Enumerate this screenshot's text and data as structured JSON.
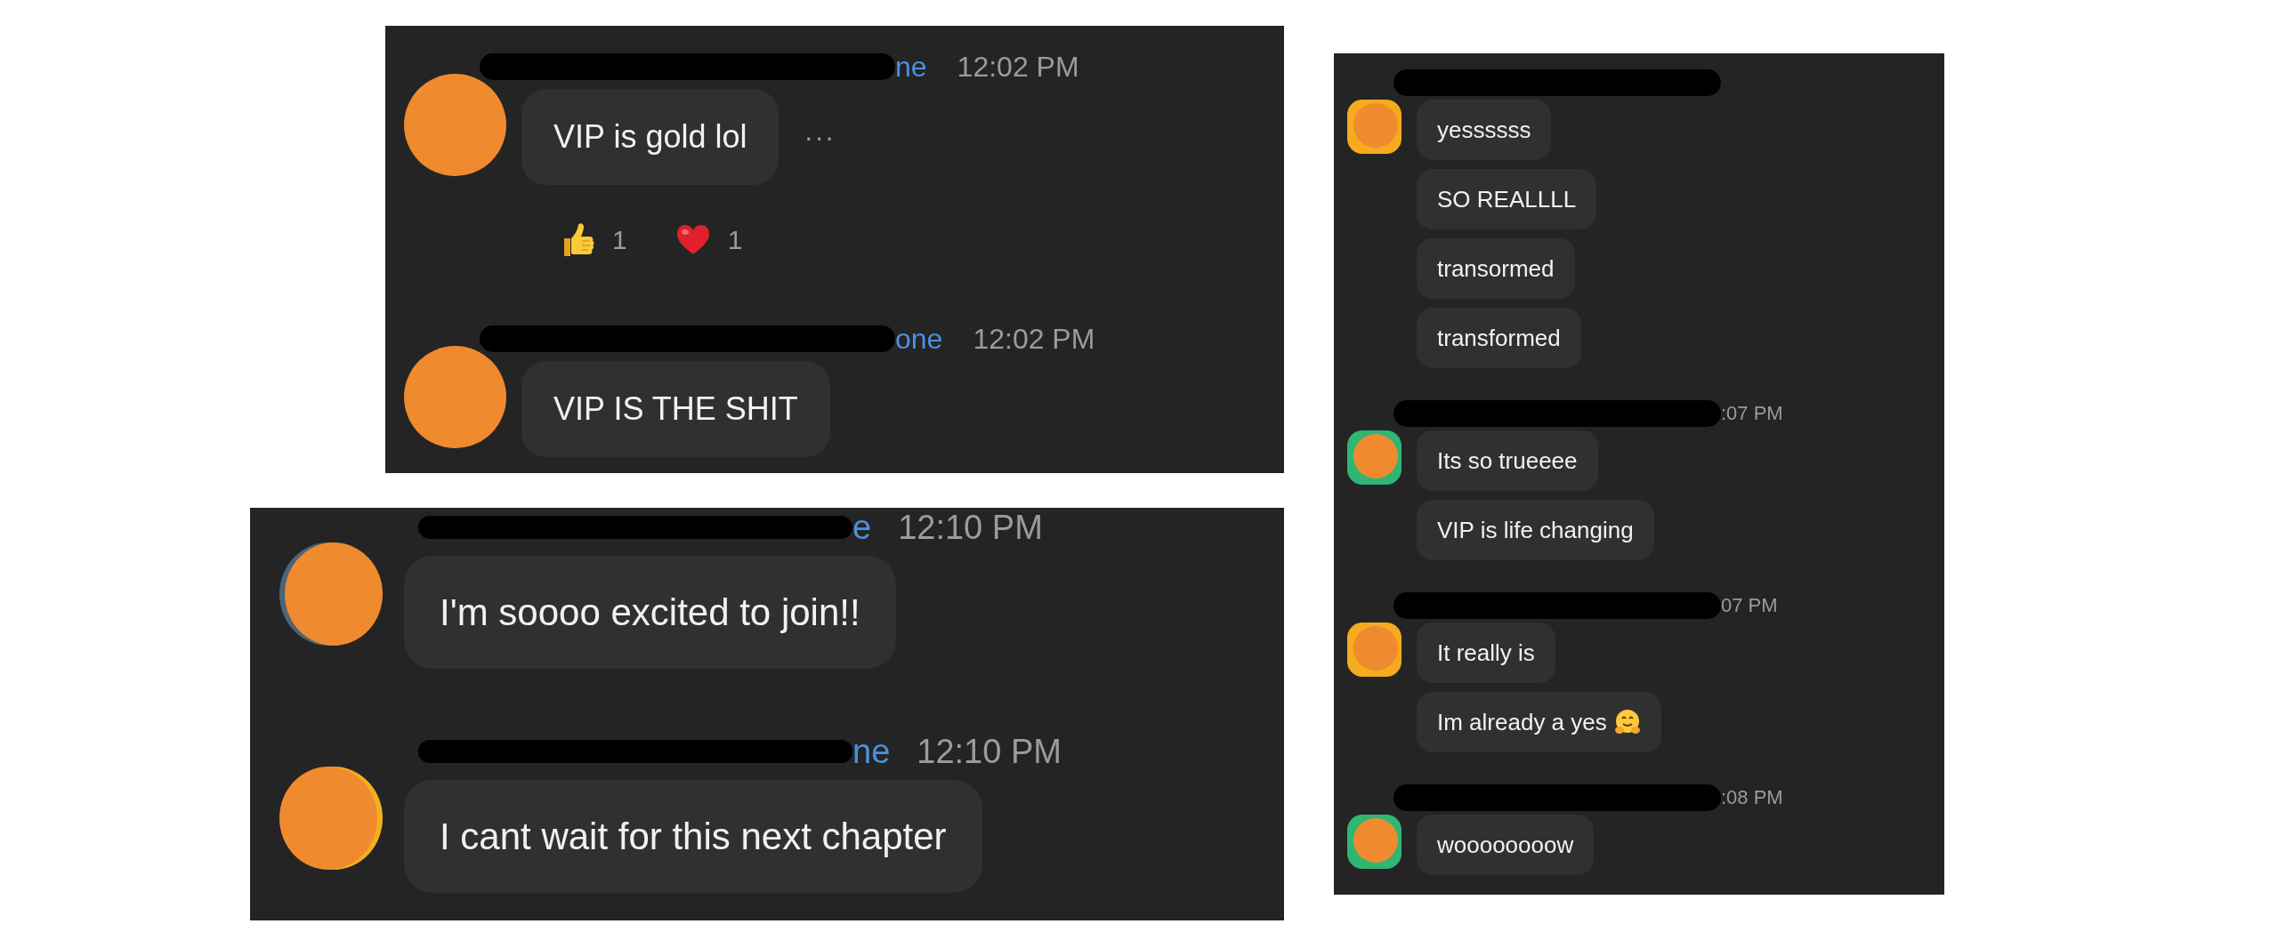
{
  "panels": [
    {
      "messages": [
        {
          "header": {
            "redacted": true,
            "recipient": "ne",
            "time": "12:02 PM"
          },
          "avatar": {
            "kind": "circle"
          },
          "lines": [
            {
              "text": "VIP is gold lol"
            }
          ],
          "more": "···",
          "reactions": [
            {
              "kind": "thumbs_up",
              "count": "1"
            },
            {
              "kind": "heart",
              "count": "1"
            }
          ]
        },
        {
          "header": {
            "redacted": true,
            "recipient": "one",
            "time": "12:02 PM"
          },
          "avatar": {
            "kind": "circle"
          },
          "lines": [
            {
              "text": "VIP IS THE SHIT"
            }
          ]
        }
      ]
    },
    {
      "messages": [
        {
          "header": {
            "redacted": true,
            "recipient": "e",
            "time": "12:10 PM"
          },
          "avatar": {
            "kind": "offset",
            "color": "#4b6478"
          },
          "lines": [
            {
              "text": "I'm soooo excited to join!!"
            }
          ]
        },
        {
          "header": {
            "redacted": true,
            "recipient": "ne",
            "time": "12:10 PM"
          },
          "avatar": {
            "kind": "offset",
            "color": "#f2b01e"
          },
          "lines": [
            {
              "text": "I cant wait for this next chapter"
            }
          ]
        }
      ]
    },
    {
      "messages": [
        {
          "header": {
            "redacted": true
          },
          "avatar": {
            "kind": "ring",
            "color": "#f5ab1f"
          },
          "lines": [
            {
              "text": "yessssss"
            },
            {
              "text": "SO REALLLL"
            },
            {
              "text": "transormed"
            },
            {
              "text": "transformed"
            }
          ]
        },
        {
          "header": {
            "redacted": true,
            "time": ":07 PM"
          },
          "avatar": {
            "kind": "ring",
            "color": "#2fb673"
          },
          "lines": [
            {
              "text": "Its so trueeee"
            },
            {
              "text": "VIP is life changing"
            }
          ]
        },
        {
          "header": {
            "redacted": true,
            "time": "07 PM"
          },
          "avatar": {
            "kind": "ring",
            "color": "#f5ab1f"
          },
          "lines": [
            {
              "text": "It really is"
            },
            {
              "text": "Im already a yes",
              "has_emoji": true
            }
          ]
        },
        {
          "header": {
            "redacted": true,
            "time": ":08 PM"
          },
          "avatar": {
            "kind": "ring",
            "color": "#2fb673"
          },
          "lines": [
            {
              "text": "woooooooow"
            }
          ]
        }
      ]
    }
  ]
}
